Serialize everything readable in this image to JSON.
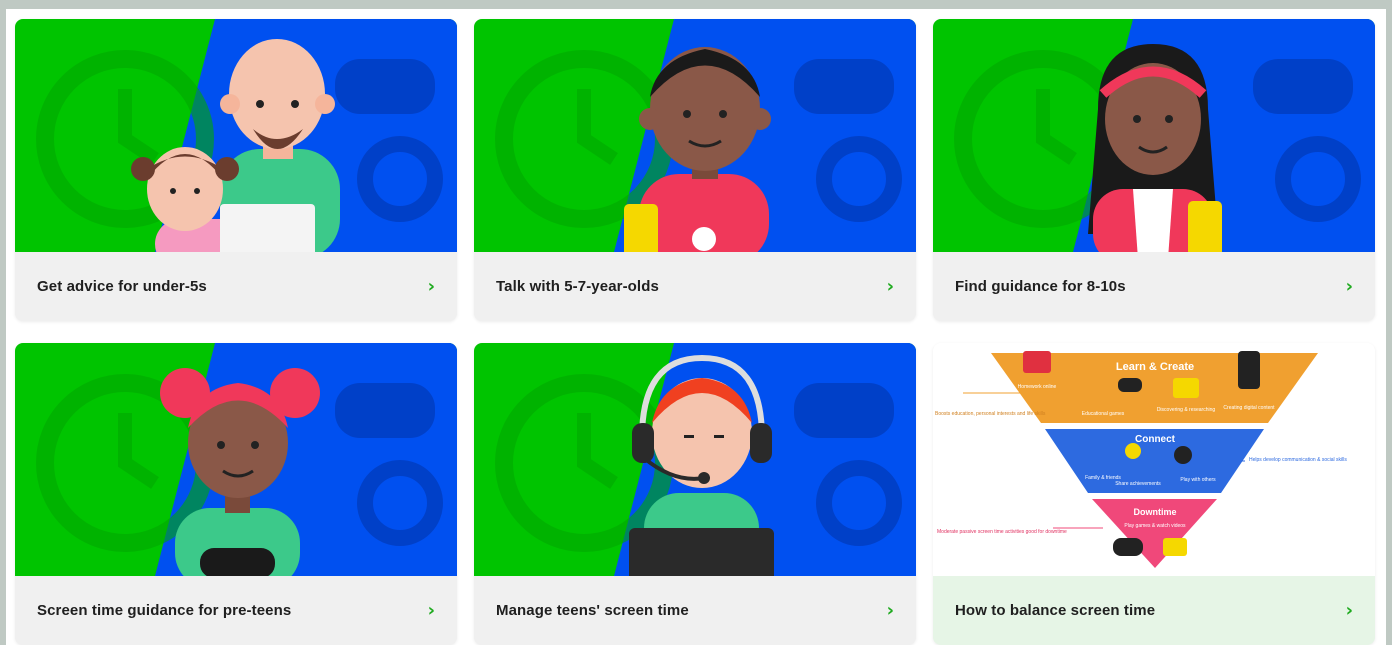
{
  "cards": [
    {
      "title": "Get advice for under-5s",
      "icon": "chevron-right-icon"
    },
    {
      "title": "Talk with 5-7-year-olds",
      "icon": "chevron-right-icon"
    },
    {
      "title": "Find guidance for 8-10s",
      "icon": "chevron-right-icon"
    },
    {
      "title": "Screen time guidance for pre-teens",
      "icon": "chevron-right-icon"
    },
    {
      "title": "Manage teens' screen time",
      "icon": "chevron-right-icon"
    },
    {
      "title": "How to balance screen time",
      "icon": "chevron-right-icon"
    }
  ],
  "chevron_glyph": "›",
  "pyramid": {
    "learn_create": {
      "title": "Learn & Create",
      "items": [
        "Homework online",
        "Educational games",
        "Discovering & researching",
        "Creating digital content"
      ],
      "side_note": "Boosts education, personal interests and life skills"
    },
    "connect": {
      "title": "Connect",
      "items": [
        "Family & friends",
        "Share achievements",
        "Play with others"
      ],
      "side_note": "Helps develop communication & social skills"
    },
    "downtime": {
      "title": "Downtime",
      "items": [
        "Play games & watch videos"
      ],
      "side_note": "Moderate passive screen time activities good for downtime"
    }
  },
  "colors": {
    "green": "#00c400",
    "blue": "#0050f0",
    "accent_chevron": "#1faa1f",
    "pyramid_orange": "#f0a030",
    "pyramid_blue": "#2d6ae0",
    "pyramid_pink": "#f0487a"
  }
}
